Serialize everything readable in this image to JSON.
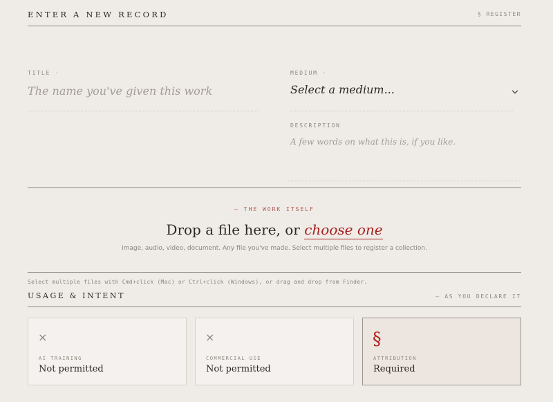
{
  "header": {
    "title": "ENTER A NEW RECORD",
    "register_link": "§ REGISTER"
  },
  "form": {
    "title": {
      "label": "TITLE ·",
      "placeholder": "The name you've given this work"
    },
    "medium": {
      "label": "MEDIUM ·",
      "value": "Select a medium..."
    },
    "description": {
      "label": "DESCRIPTION",
      "placeholder": "A few words on what this is, if you like."
    }
  },
  "upload": {
    "eyebrow": "— THE WORK ITSELF",
    "prompt_prefix": "Drop a file here, or ",
    "choose_link": "choose one",
    "helper": "Image, audio, video, document. Any file you've made. Select multiple files to register a collection."
  },
  "selection_note": "Select multiple files with Cmd+click (Mac) or Ctrl+click (Windows), or drag and drop from Finder.",
  "usage": {
    "title": "USAGE & INTENT",
    "aside": "— AS YOU DECLARE IT",
    "cards": [
      {
        "icon": "×",
        "label": "AI TRAINING",
        "value": "Not permitted"
      },
      {
        "icon": "×",
        "label": "COMMERCIAL USE",
        "value": "Not permitted"
      },
      {
        "icon": "§",
        "label": "ATTRIBUTION",
        "value": "Required"
      }
    ]
  },
  "colors": {
    "background": "#efebe7",
    "accent": "#a51f1f",
    "rule": "#8b8580",
    "muted": "#8f8880"
  }
}
